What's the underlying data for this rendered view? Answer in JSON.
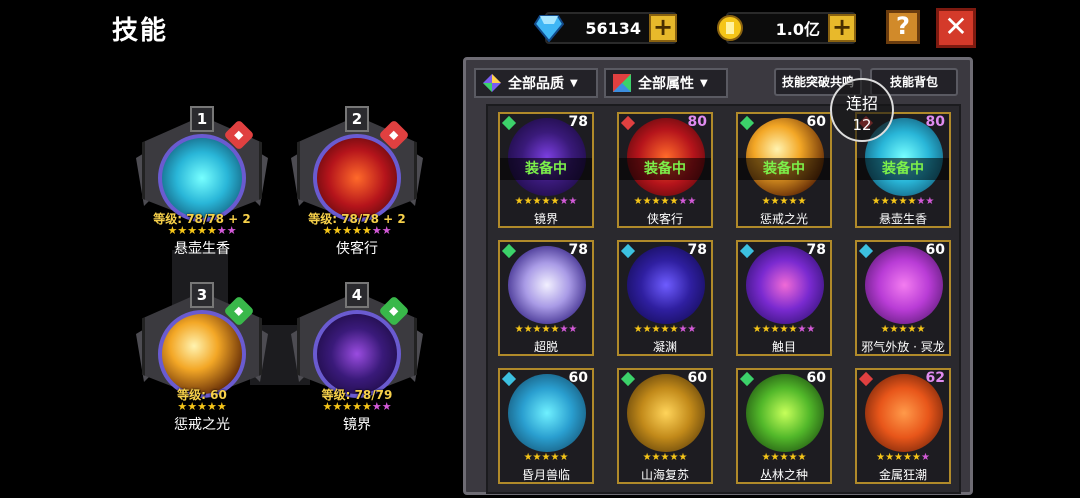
{
  "title": "技能",
  "currency": {
    "gems": "56134",
    "gold": "1.0亿",
    "plus": "+"
  },
  "buttons": {
    "help": "?",
    "close": "✕"
  },
  "equipped": [
    {
      "num": "1",
      "level": "等级: 78/78 + 2",
      "name": "悬壶生香",
      "yellow": 5,
      "purple": 2,
      "badge_color": "#e04040",
      "orb": "radial-gradient(circle, #7ff 0%, #29b6d8 45%, #0b3a55 100%)"
    },
    {
      "num": "2",
      "level": "等级: 78/78 + 2",
      "name": "侠客行",
      "yellow": 5,
      "purple": 2,
      "badge_color": "#e04040",
      "orb": "radial-gradient(circle, #ff6a2a 0%, #b5141b 50%, #3c0508 100%)"
    },
    {
      "num": "3",
      "level": "等级: 60",
      "name": "惩戒之光",
      "yellow": 5,
      "purple": 0,
      "badge_color": "#39b84a",
      "orb": "radial-gradient(circle at 40% 40%, #fff3b0 0%, #f3a726 35%, #6b3208 75%, #2a1203 100%)"
    },
    {
      "num": "4",
      "level": "等级: 78/79",
      "name": "镜界",
      "yellow": 5,
      "purple": 2,
      "badge_color": "#39b84a",
      "orb": "radial-gradient(circle, #9a4ce0 0%, #3a1a7a 45%, #120630 100%)"
    }
  ],
  "filters": {
    "quality": "全部品质",
    "attribute": "全部属性"
  },
  "tabs": {
    "resonance": "技能突破共鸣",
    "bag": "技能背包"
  },
  "combo": {
    "label": "连招",
    "value": "12"
  },
  "equipped_label": "装备中",
  "skills": [
    {
      "name": "镜界",
      "level": "78",
      "equipped": true,
      "gem": "#3cd26a",
      "level_color": "#ffffff",
      "yellow": 5,
      "purple": 2,
      "bg": "radial-gradient(circle, #7b3ee0 0%, #3a1a7a 45%, #120630 100%)"
    },
    {
      "name": "侠客行",
      "level": "80",
      "equipped": true,
      "gem": "#e04040",
      "level_color": "#e08cf0",
      "yellow": 5,
      "purple": 2,
      "bg": "radial-gradient(circle, #ff6a2a 0%, #b5141b 50%, #3c0508 100%)"
    },
    {
      "name": "惩戒之光",
      "level": "60",
      "equipped": true,
      "gem": "#3cd26a",
      "level_color": "#ffffff",
      "yellow": 5,
      "purple": 0,
      "bg": "radial-gradient(circle at 40% 40%, #fff3b0 0%, #f3a726 35%, #6b3208 75%, #2a1203 100%)"
    },
    {
      "name": "悬壶生香",
      "level": "80",
      "equipped": true,
      "gem": "#e04040",
      "level_color": "#e08cf0",
      "yellow": 5,
      "purple": 2,
      "bg": "radial-gradient(circle, #7ff 0%, #29b6d8 45%, #0b3a55 100%)"
    },
    {
      "name": "超脱",
      "level": "78",
      "equipped": false,
      "gem": "#3cd26a",
      "level_color": "#ffffff",
      "yellow": 5,
      "purple": 2,
      "bg": "radial-gradient(circle, #f2f0ff 0%, #a99be6 40%, #3b2a8a 80%, #140c3a 100%)"
    },
    {
      "name": "凝渊",
      "level": "78",
      "equipped": false,
      "gem": "#3cc0e0",
      "level_color": "#ffffff",
      "yellow": 5,
      "purple": 2,
      "bg": "radial-gradient(circle, #6e5cff 0%, #2f1fa0 45%, #0c0640 100%)"
    },
    {
      "name": "触目",
      "level": "78",
      "equipped": false,
      "gem": "#3cc0e0",
      "level_color": "#ffffff",
      "yellow": 5,
      "purple": 2,
      "bg": "radial-gradient(circle, #f06ad6 0%, #7a2ad0 45%, #1a0a55 100%)"
    },
    {
      "name": "邪气外放 · 冥龙",
      "level": "60",
      "equipped": false,
      "gem": "#3cc0e0",
      "level_color": "#ffffff",
      "yellow": 5,
      "purple": 0,
      "bg": "radial-gradient(circle, #f37cf0 0%, #b93cd6 45%, #3b0f55 100%)"
    },
    {
      "name": "昏月兽临",
      "level": "60",
      "equipped": false,
      "gem": "#3cc0e0",
      "level_color": "#ffffff",
      "yellow": 5,
      "purple": 0,
      "bg": "radial-gradient(circle, #6ff0ff 0%, #2a9fd0 45%, #0e3a55 100%)"
    },
    {
      "name": "山海复苏",
      "level": "60",
      "equipped": false,
      "gem": "#3cd26a",
      "level_color": "#ffffff",
      "yellow": 5,
      "purple": 0,
      "bg": "radial-gradient(circle, #ffd45a 0%, #c28a1a 45%, #3c2604 100%)"
    },
    {
      "name": "丛林之种",
      "level": "60",
      "equipped": false,
      "gem": "#3cd26a",
      "level_color": "#ffffff",
      "yellow": 5,
      "purple": 0,
      "bg": "radial-gradient(circle, #c6ff5a 0%, #52b82a 45%, #0d2c08 100%)"
    },
    {
      "name": "金属狂潮",
      "level": "62",
      "equipped": false,
      "gem": "#e04040",
      "level_color": "#e08cf0",
      "yellow": 5,
      "purple": 1,
      "bg": "radial-gradient(circle, #ff9a4a 0%, #e8561a 45%, #4a1204 100%)"
    }
  ]
}
